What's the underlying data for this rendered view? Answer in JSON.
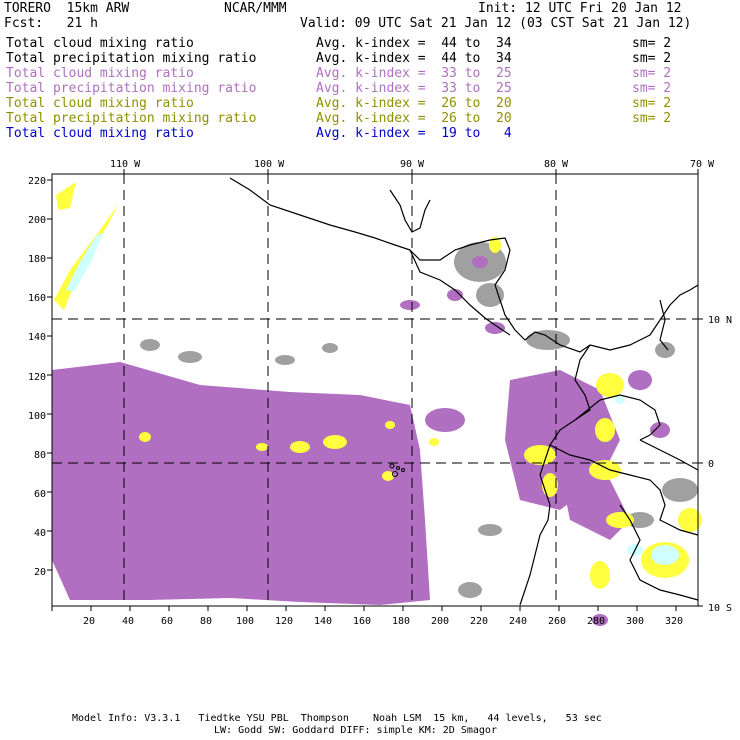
{
  "header": {
    "model": "TORERO  15km ARW",
    "org": "NCAR/MMM",
    "init": "Init: 12 UTC Fri 20 Jan 12",
    "fcst": "Fcst:   21 h",
    "valid": "Valid: 09 UTC Sat 21 Jan 12 (03 CST Sat 21 Jan 12)"
  },
  "legend": [
    {
      "field": "Total cloud mixing ratio",
      "kindex": "Avg. k-index =  44 to  34",
      "sm": "sm= 2",
      "color": "#000000"
    },
    {
      "field": "Total precipitation mixing ratio",
      "kindex": "Avg. k-index =  44 to  34",
      "sm": "sm= 2",
      "color": "#000000"
    },
    {
      "field": "Total cloud mixing ratio",
      "kindex": "Avg. k-index =  33 to  25",
      "sm": "sm= 2",
      "color": "#b070c0"
    },
    {
      "field": "Total precipitation mixing ratio",
      "kindex": "Avg. k-index =  33 to  25",
      "sm": "sm= 2",
      "color": "#b070c0"
    },
    {
      "field": "Total cloud mixing ratio",
      "kindex": "Avg. k-index =  26 to  20",
      "sm": "sm= 2",
      "color": "#909000"
    },
    {
      "field": "Total precipitation mixing ratio",
      "kindex": "Avg. k-index =  26 to  20",
      "sm": "sm= 2",
      "color": "#909000"
    },
    {
      "field": "Total cloud mixing ratio",
      "kindex": "Avg. k-index =  19 to   4",
      "sm": "",
      "color": "#0000cc"
    }
  ],
  "map": {
    "top_lon_labels": [
      "110 W",
      "100 W",
      "90 W",
      "80 W",
      "70 W"
    ],
    "right_lat_labels": [
      "10 N",
      "0",
      "10 S"
    ],
    "left_y_ticks": [
      "220",
      "200",
      "180",
      "160",
      "140",
      "120",
      "100",
      "80",
      "60",
      "40",
      "20"
    ],
    "bottom_x_ticks": [
      "20",
      "40",
      "60",
      "80",
      "100",
      "120",
      "140",
      "160",
      "180",
      "200",
      "220",
      "240",
      "260",
      "280",
      "300",
      "320"
    ],
    "colors": {
      "gray_cloud": "#a0a0a0",
      "purple_cloud": "#b06fc0",
      "yellow_cloud": "#ffff40",
      "cyan_cloud": "#d0ffff",
      "coast": "#000000"
    }
  },
  "footer": {
    "line1": "Model Info: V3.3.1   Tiedtke YSU PBL  Thompson    Noah LSM  15 km,   44 levels,   53 sec",
    "line2": "LW: Godd SW: Goddard DIFF: simple KM: 2D Smagor"
  }
}
